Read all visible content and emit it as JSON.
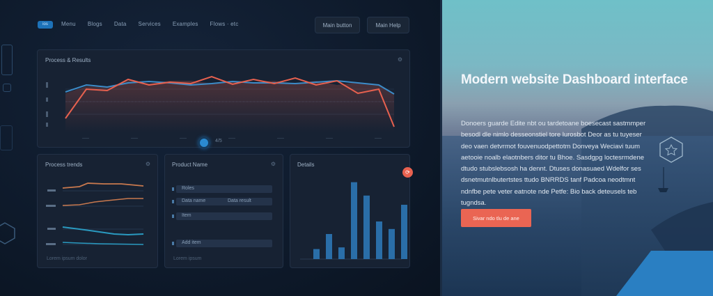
{
  "app": {
    "logo_text": "ios"
  },
  "nav": {
    "items": [
      "Menu",
      "Blogs",
      "Data",
      "Services",
      "Examples",
      "Flows · etc"
    ]
  },
  "header_buttons": {
    "primary": "Main button",
    "secondary": "Main Help"
  },
  "main_chart": {
    "title": "Process & Results",
    "pager_label": "4/5"
  },
  "panel_trends": {
    "title": "Process trends",
    "footer": "Lorem ipsum dolor"
  },
  "panel_list": {
    "title": "Product Name",
    "rows": [
      {
        "label": "Roles",
        "value": ""
      },
      {
        "label": "Data name",
        "value": "Data result"
      },
      {
        "label": "Item",
        "value": ""
      },
      {
        "label": "Add item",
        "value": ""
      }
    ],
    "footer": "Lorem ipsum"
  },
  "panel_bars": {
    "title": "Details",
    "values": [
      0.12,
      0.3,
      0.14,
      0.92,
      0.76,
      0.45,
      0.36,
      0.65
    ]
  },
  "hero": {
    "title": "Modern website Dashboard interface",
    "body": "Donoers guarde Edite nbt ou tardetoane boesecast sastmmper besodl dle nimlo desseonstiel tore lurosbot Deor as tu tuyeser deo vaen detvrmot fouvenuodpettotm Donveya Weciavi tuum aetooie noalb elaotnbers ditor tu Bhoe. Sasdgpg loctesrmdene dtudo stubslebsosh ha dennt. Dtuses donasuaed Wdelfor ses dsnetmutnlbutertstes ttudo BNRRDS tanf Padcoa neodtmnt ndnfbe pete veter eatnote nde Petfe: Bio back deteusels teb tugndsa.",
    "cta": "Sivar ndo tlu de ane"
  },
  "colors": {
    "accent_red": "#ea6553",
    "accent_blue": "#2b8ad0",
    "line_blue": "#3c8cc8",
    "bg_dark": "#0d1726"
  }
}
